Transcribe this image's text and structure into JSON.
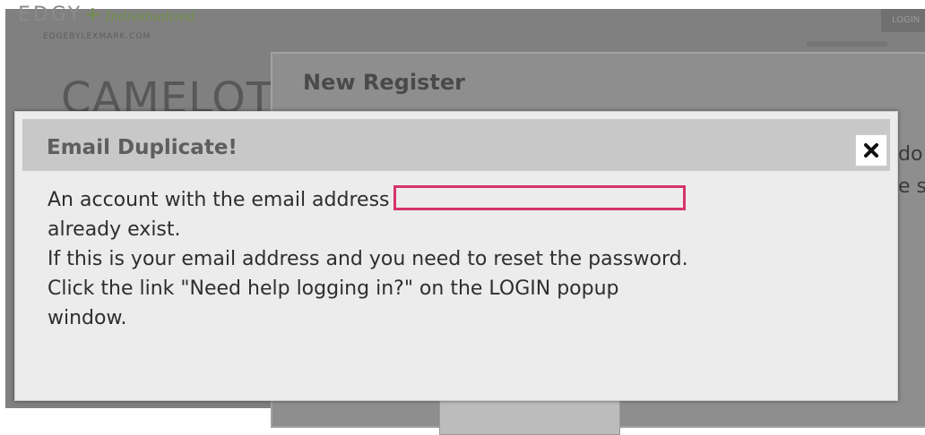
{
  "site": {
    "logo": {
      "brand": "EDGY",
      "plus": "+",
      "tagline": "Individualized",
      "url_text": "EDGEBYLEXMARK.COM"
    },
    "login_button": "LOGIN",
    "page_heading": "CAMELOT"
  },
  "register_modal": {
    "title": "New Register",
    "peek_text_1": "do",
    "peek_text_2": "e s"
  },
  "dialog": {
    "title": "Email Duplicate!",
    "message_prefix": "An account with the email address",
    "email_value": "",
    "line_2": "already exist.",
    "line_3": "If this is your email address and you need to reset the password.",
    "line_4": "Click the link \"Need help logging in?\" on the LOGIN popup",
    "line_5": "window."
  },
  "icons": {
    "close": "close-icon"
  },
  "colors": {
    "highlight_border": "#d6336c",
    "dialog_header_bg": "#c8c8c8",
    "dialog_bg": "#ececec",
    "overlay": "#808080"
  }
}
